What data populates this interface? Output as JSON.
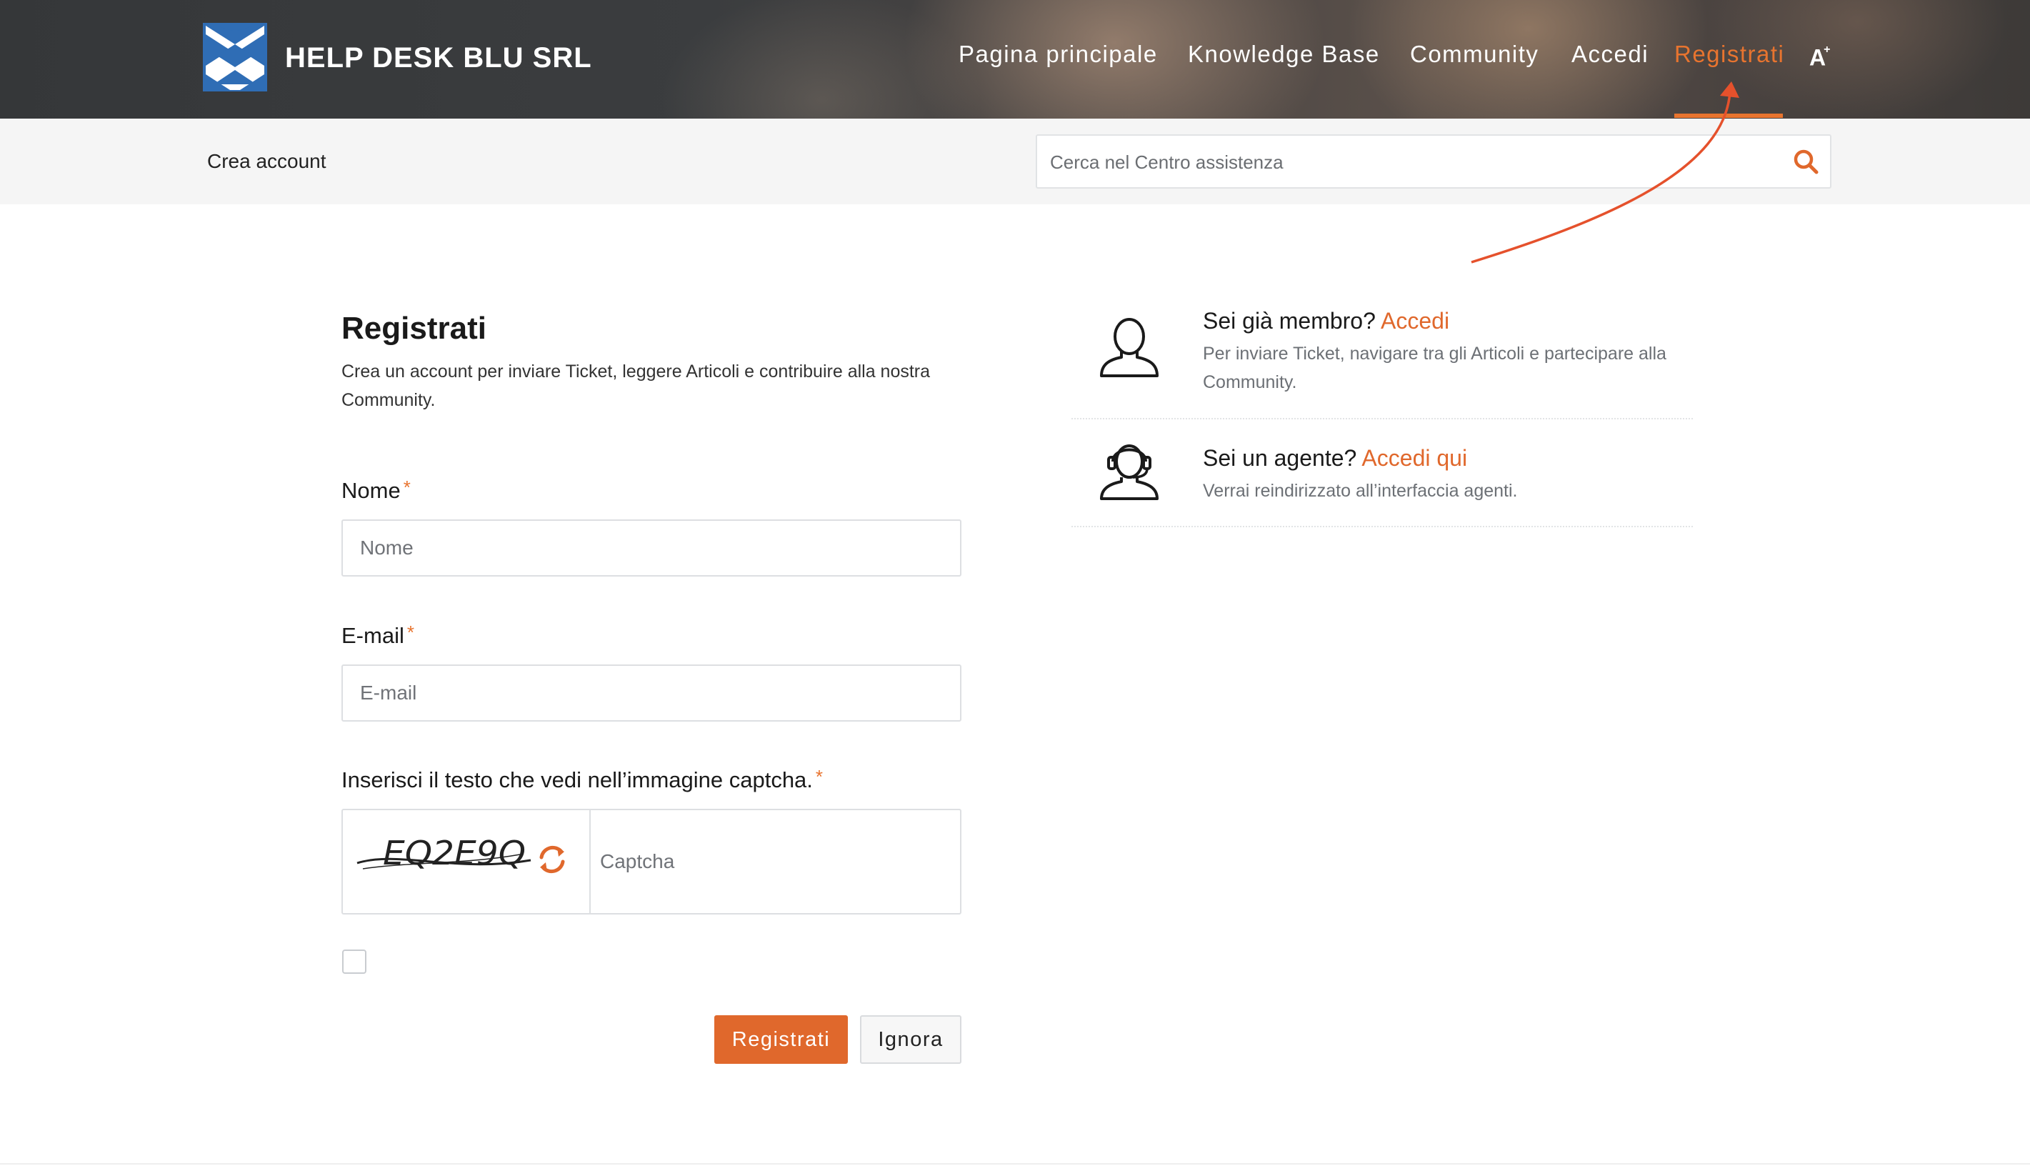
{
  "brand": {
    "name": "HELP DESK BLU SRL",
    "logo_icon": "blue-cross-logo",
    "logo_color": "#2f6db5"
  },
  "nav": {
    "items": [
      {
        "label": "Pagina principale"
      },
      {
        "label": "Knowledge Base"
      },
      {
        "label": "Community"
      },
      {
        "label": "Accedi"
      },
      {
        "label": "Registrati",
        "active": true
      }
    ],
    "font_toggle": "A",
    "font_toggle_sup": "+",
    "active_color": "#e8742f"
  },
  "subheader": {
    "breadcrumb": "Crea account",
    "search_placeholder": "Cerca nel Centro assistenza",
    "search_icon": "search-icon"
  },
  "form": {
    "title": "Registrati",
    "subtitle": "Crea un account per inviare Ticket, leggere Articoli e contribuire alla nostra Community.",
    "name_label": "Nome",
    "name_placeholder": "Nome",
    "email_label": "E-mail",
    "email_placeholder": "E-mail",
    "captcha_label": "Inserisci il testo che vedi nell’immagine captcha.",
    "captcha_image_text": "EQ2E9Q",
    "captcha_placeholder": "Captcha",
    "required_mark": "*",
    "submit_label": "Registrati",
    "cancel_label": "Ignora",
    "accent_color": "#e0682c"
  },
  "side": {
    "member": {
      "icon": "user-icon",
      "question": "Sei già membro?",
      "link": "Accedi",
      "desc": "Per inviare Ticket, navigare tra gli Articoli e partecipare alla Community."
    },
    "agent": {
      "icon": "headset-agent-icon",
      "question": "Sei un agente?",
      "link": "Accedi qui",
      "desc": "Verrai reindirizzato all’interfaccia agenti."
    }
  }
}
